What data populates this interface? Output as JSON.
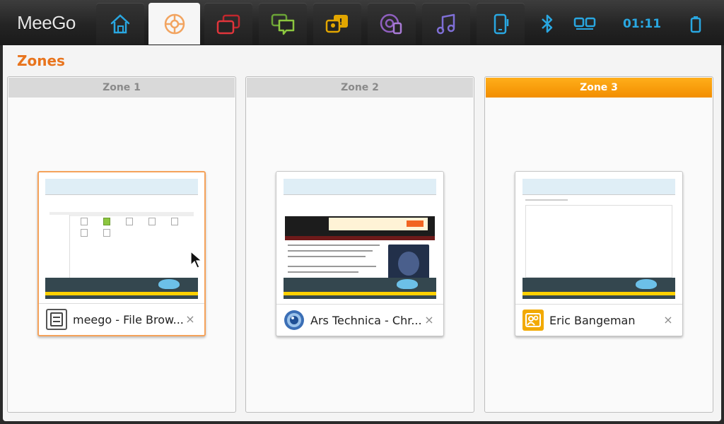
{
  "brand": "MeeGo",
  "toolbar": {
    "clock": "01:11",
    "buttons": [
      {
        "name": "home-icon"
      },
      {
        "name": "zones-icon",
        "active": true
      },
      {
        "name": "applications-icon"
      },
      {
        "name": "status-icon"
      },
      {
        "name": "people-icon"
      },
      {
        "name": "internet-icon"
      },
      {
        "name": "media-icon"
      },
      {
        "name": "devices-icon"
      },
      {
        "name": "bluetooth-icon"
      },
      {
        "name": "network-icon"
      },
      {
        "name": "battery-icon"
      }
    ]
  },
  "panel": {
    "title": "Zones"
  },
  "zones": [
    {
      "label": "Zone 1",
      "selected": false,
      "window": {
        "title": "meego - File Brow...",
        "close": "×",
        "focused": true,
        "icon": "file-browser-icon"
      }
    },
    {
      "label": "Zone 2",
      "selected": false,
      "window": {
        "title": "Ars Technica - Chr...",
        "close": "×",
        "focused": false,
        "icon": "chromium-icon"
      }
    },
    {
      "label": "Zone 3",
      "selected": true,
      "window": {
        "title": "Eric Bangeman",
        "close": "×",
        "focused": false,
        "icon": "contact-icon"
      }
    }
  ],
  "colors": {
    "accent": "#e8741d",
    "zone_selected": "#f6a012",
    "clock": "#29a7e1"
  }
}
